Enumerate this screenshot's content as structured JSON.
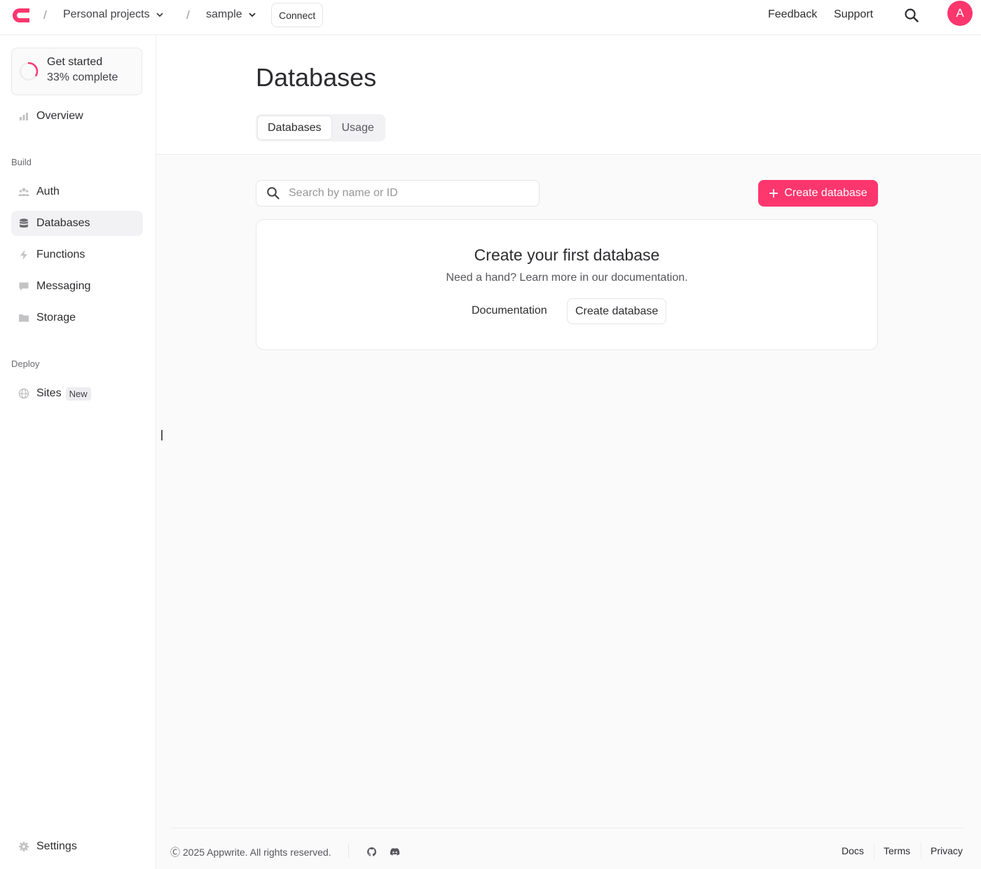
{
  "header": {
    "breadcrumb": [
      "Personal projects",
      "sample"
    ],
    "connect_label": "Connect",
    "feedback_label": "Feedback",
    "support_label": "Support",
    "avatar_initial": "A",
    "brand_color": "#fd366e"
  },
  "sidebar": {
    "get_started": {
      "title": "Get started",
      "progress_text": "33% complete",
      "progress_fraction": 0.33
    },
    "overview": "Overview",
    "build_label": "Build",
    "items": [
      {
        "label": "Auth",
        "icon": "users-icon"
      },
      {
        "label": "Databases",
        "icon": "database-icon"
      },
      {
        "label": "Functions",
        "icon": "lightning-icon"
      },
      {
        "label": "Messaging",
        "icon": "message-icon"
      },
      {
        "label": "Storage",
        "icon": "folder-icon"
      }
    ],
    "deploy_label": "Deploy",
    "sites": {
      "label": "Sites",
      "badge": "New"
    },
    "settings": "Settings"
  },
  "main": {
    "title": "Databases",
    "tabs": [
      "Databases",
      "Usage"
    ],
    "search_placeholder": "Search by name or ID",
    "create_button": "Create database",
    "empty": {
      "title": "Create your first database",
      "subtitle": "Need a hand? Learn more in our documentation.",
      "doc_link": "Documentation",
      "create_button": "Create database"
    }
  },
  "footer": {
    "copyright": "2025 Appwrite. All rights reserved.",
    "links": [
      "Docs",
      "Terms",
      "Privacy"
    ]
  }
}
